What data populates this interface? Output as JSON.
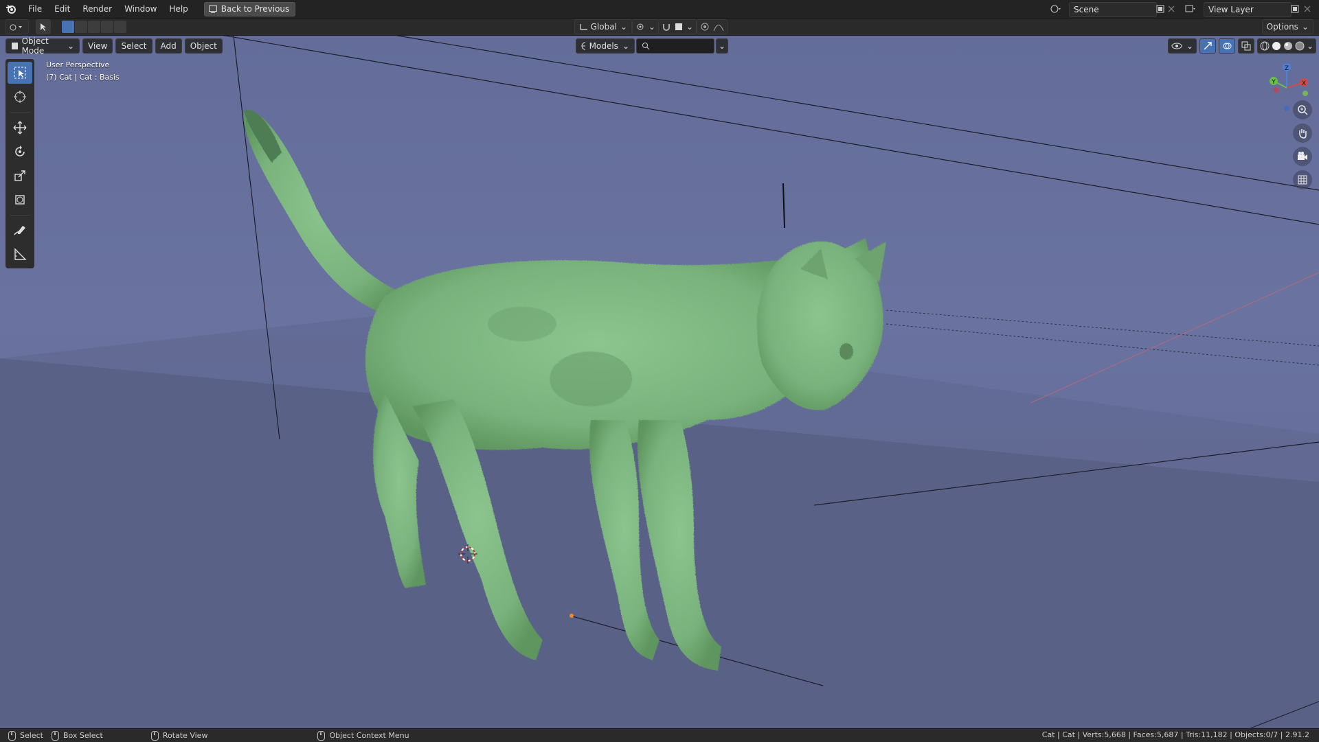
{
  "menu": {
    "items": [
      "File",
      "Edit",
      "Render",
      "Window",
      "Help"
    ],
    "back_button": "Back to Previous"
  },
  "scene": {
    "name": "Scene"
  },
  "view_layer": {
    "name": "View Layer"
  },
  "header": {
    "transform_orientation": "Global",
    "options_label": "Options",
    "collection_filter": "Models",
    "search_placeholder": ""
  },
  "viewport_header": {
    "mode": "Object Mode",
    "menus": [
      "View",
      "Select",
      "Add",
      "Object"
    ]
  },
  "viewport_info": {
    "line1": "User Perspective",
    "line2": "(7) Cat | Cat : Basis"
  },
  "gizmo": {
    "axes": [
      "X",
      "Y",
      "Z"
    ]
  },
  "status": {
    "left_items": [
      "Select",
      "Box Select",
      "Rotate View",
      "Object Context Menu"
    ],
    "stats": "Cat | Cat | Verts:5,668 | Faces:5,687 | Tris:11,182 | Objects:0/7 | 2.91.2"
  },
  "colors": {
    "accent": "#4772b3",
    "viewport_bg": "#6a73a0",
    "floor": "#5a6186",
    "selection_green": "#7fbf80"
  },
  "icons": {
    "logo": "blender-logo-icon",
    "tools": [
      "select-box-icon",
      "cursor-icon",
      "move-icon",
      "rotate-icon",
      "scale-icon",
      "transform-icon",
      "annotate-icon",
      "measure-icon"
    ],
    "nav": [
      "zoom-icon",
      "pan-hand-icon",
      "camera-icon",
      "grid-ortho-icon"
    ]
  }
}
